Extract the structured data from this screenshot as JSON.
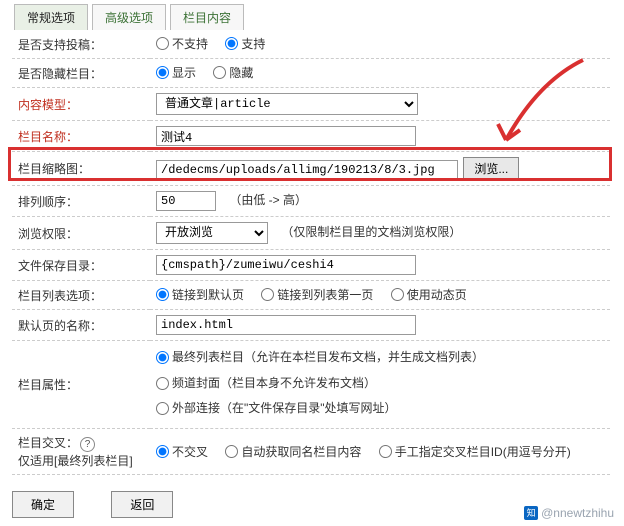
{
  "tabs": {
    "t0": "常规选项",
    "t1": "高级选项",
    "t2": "栏目内容"
  },
  "rows": {
    "support_post": {
      "label": "是否支持投稿：",
      "opt1": "不支持",
      "opt2": "支持"
    },
    "hidden": {
      "label": "是否隐藏栏目：",
      "opt1": "显示",
      "opt2": "隐藏"
    },
    "model": {
      "label": "内容模型：",
      "value": "普通文章|article"
    },
    "name": {
      "label": "栏目名称：",
      "value": "测试4"
    },
    "thumb": {
      "label": "栏目缩略图：",
      "value": "/dedecms/uploads/allimg/190213/8/3.jpg",
      "browse": "浏览..."
    },
    "sort": {
      "label": "排列顺序：",
      "value": "50",
      "note": "（由低 -> 高）"
    },
    "perm": {
      "label": "浏览权限：",
      "value": "开放浏览",
      "note": "（仅限制栏目里的文档浏览权限）"
    },
    "savepath": {
      "label": "文件保存目录：",
      "value": "{cmspath}/zumeiwu/ceshi4"
    },
    "listopt": {
      "label": "栏目列表选项：",
      "opt1": "链接到默认页",
      "opt2": "链接到列表第一页",
      "opt3": "使用动态页"
    },
    "default": {
      "label": "默认页的名称：",
      "value": "index.html"
    },
    "attr": {
      "label": "栏目属性：",
      "opt1": "最终列表栏目（允许在本栏目发布文档，并生成文档列表）",
      "opt2": "频道封面（栏目本身不允许发布文档）",
      "opt3": "外部连接（在\"文件保存目录\"处填写网址）"
    },
    "cross": {
      "label1": "栏目交叉：",
      "label2": "仅适用[最终列表栏目]",
      "opt1": "不交叉",
      "opt2": "自动获取同名栏目内容",
      "opt3": "手工指定交叉栏目ID(用逗号分开)"
    }
  },
  "footer": {
    "ok": "确定",
    "back": "返回"
  },
  "watermark": "@nnewtzhihu"
}
